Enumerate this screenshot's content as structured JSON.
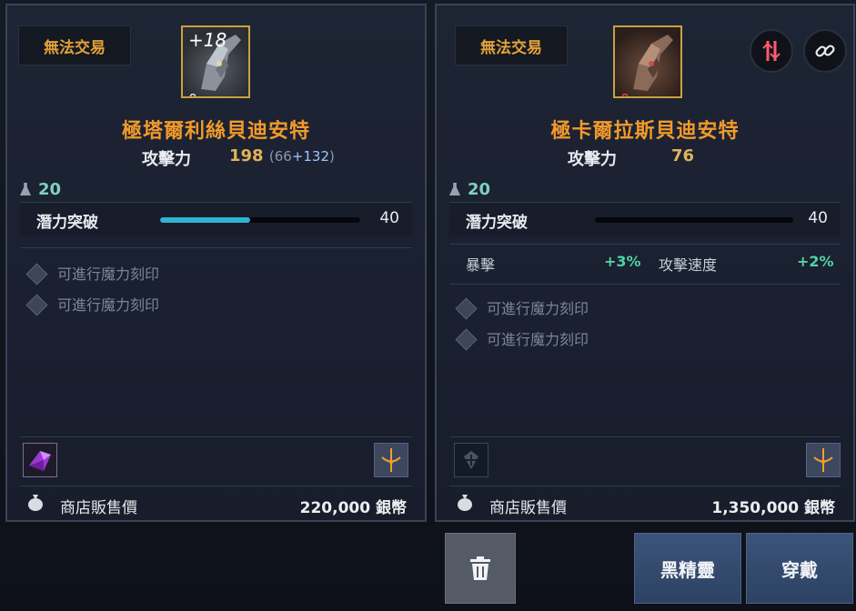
{
  "left": {
    "tag": "無法交易",
    "enhance": "+18",
    "name": "極塔爾利絲貝迪安特",
    "attack_label": "攻擊力",
    "attack_value": "198",
    "attack_base": "66",
    "attack_bonus": "+132",
    "level": "20",
    "potential_label": "潛力突破",
    "potential_value": "40",
    "potential_fill": 0.45,
    "engrave_1": "可進行魔力刻印",
    "engrave_2": "可進行魔力刻印",
    "sell_label": "商店販售價",
    "sell_value": "220,000 銀幣"
  },
  "right": {
    "tag": "無法交易",
    "name": "極卡爾拉斯貝迪安特",
    "attack_label": "攻擊力",
    "attack_value": "76",
    "level": "20",
    "potential_label": "潛力突破",
    "potential_value": "40",
    "potential_fill": 0.0,
    "stat_1_name": "暴擊",
    "stat_1_value": "+3%",
    "stat_2_name": "攻擊速度",
    "stat_2_value": "+2%",
    "engrave_1": "可進行魔力刻印",
    "engrave_2": "可進行魔力刻印",
    "sell_label": "商店販售價",
    "sell_value": "1,350,000 銀幣"
  },
  "buttons": {
    "dark_elf": "黑精靈",
    "equip": "穿戴"
  },
  "icons": {
    "delete": "trash-icon",
    "link": "link-icon",
    "compare": "compare-icon"
  },
  "colors": {
    "item_name": "#f19a2a",
    "tag_text": "#e2a23a",
    "stat_positive": "#4fd3a8",
    "potential_bar": "#2fb3d3",
    "button_blue": "#3b5479"
  }
}
